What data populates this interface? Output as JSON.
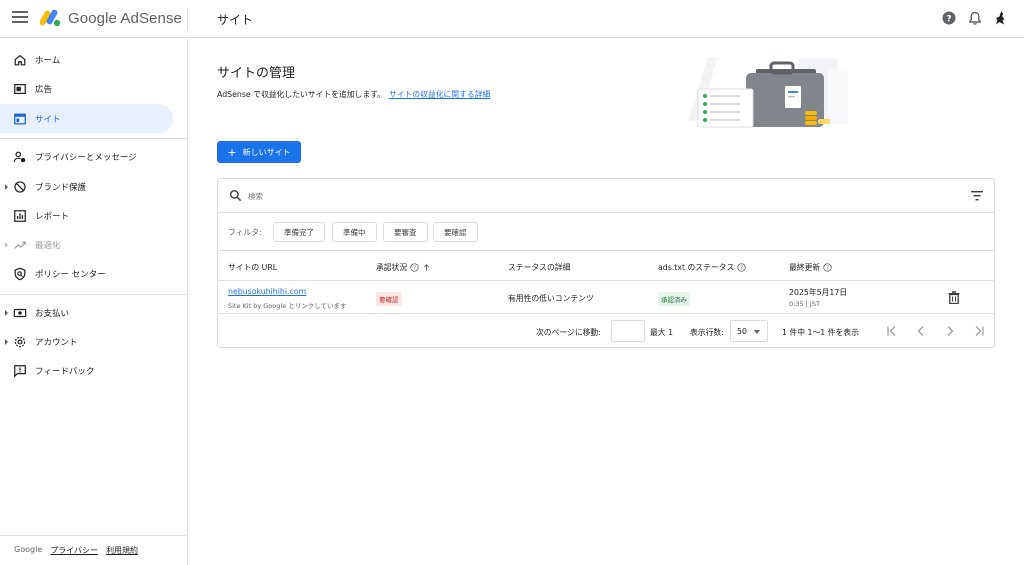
{
  "app": {
    "brand": "Google AdSense",
    "section_title": "サイト"
  },
  "sidebar": {
    "items": [
      {
        "label": "ホーム",
        "icon": "home-icon"
      },
      {
        "label": "広告",
        "icon": "ads-icon"
      },
      {
        "label": "サイト",
        "icon": "sites-icon",
        "active": true
      },
      {
        "label": "プライバシーとメッセージ",
        "icon": "privacy-icon"
      },
      {
        "label": "ブランド保護",
        "icon": "block-icon"
      },
      {
        "label": "レポート",
        "icon": "report-icon"
      },
      {
        "label": "最適化",
        "icon": "trending-icon",
        "disabled": true
      },
      {
        "label": "ポリシー センター",
        "icon": "policy-icon"
      },
      {
        "label": "お支払い",
        "icon": "payments-icon"
      },
      {
        "label": "アカウント",
        "icon": "settings-icon"
      },
      {
        "label": "フィードバック",
        "icon": "feedback-icon"
      }
    ],
    "footer": {
      "brand": "Google",
      "privacy": "プライバシー",
      "terms": "利用規約"
    }
  },
  "main": {
    "title": "サイトの管理",
    "description": "AdSense で収益化したいサイトを追加します。",
    "description_link": "サイトの収益化に関する詳細",
    "new_site_button": "新しいサイト",
    "search_placeholder": "検索",
    "filter_label": "フィルタ:",
    "filter_chips": [
      "準備完了",
      "準備中",
      "要審査",
      "要確認"
    ],
    "columns": {
      "url": "サイトの URL",
      "approval": "承認状況",
      "status_detail": "ステータスの詳細",
      "ads_txt": "ads.txt のステータス",
      "last_updated": "最終更新"
    },
    "rows": [
      {
        "url": "nebusokuhihihi.com",
        "sub": "Site Kit by Google とリンクしています",
        "approval": "要確認",
        "status_detail": "有用性の低いコンテンツ",
        "ads_txt": "承認済み",
        "date": "2025年5月17日",
        "time": "0:35 | JST"
      }
    ],
    "pagination": {
      "goto_label": "次のページに移動:",
      "max_label": "最大 1",
      "rows_label": "表示行数:",
      "rows_value": "50",
      "range_label": "1 件中 1～1 件を表示"
    }
  },
  "colors": {
    "accent": "#1a73e8",
    "active_bg": "#e8f0fe",
    "error_bg": "#fce8e6",
    "success_bg": "#e6f4ea"
  }
}
